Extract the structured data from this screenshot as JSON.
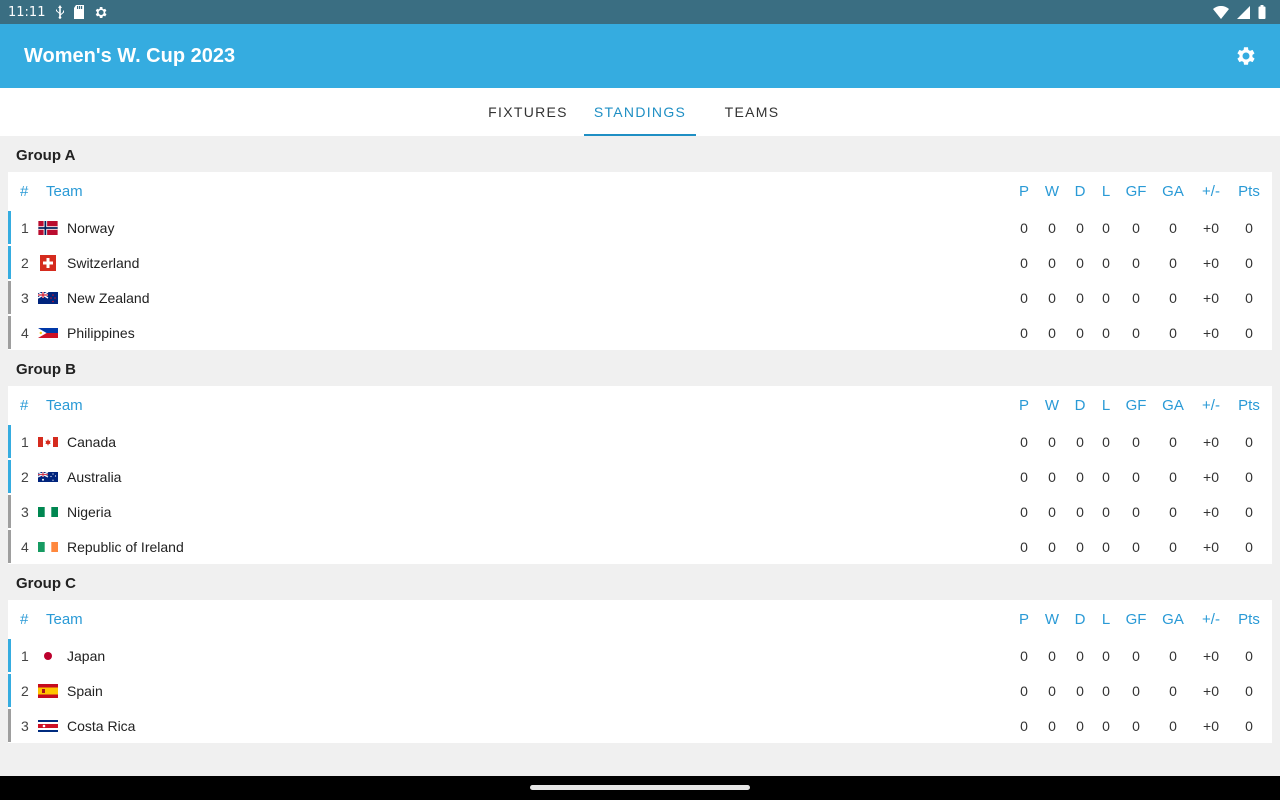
{
  "status_bar": {
    "time": "11:11",
    "icons": [
      "usb-icon",
      "sd-card-icon",
      "settings-sync-icon",
      "wifi-icon",
      "signal-icon",
      "battery-icon"
    ]
  },
  "app_bar": {
    "title": "Women's W. Cup 2023",
    "settings_icon": "gear-icon",
    "color": "#35ace0"
  },
  "tabs": [
    {
      "label": "FIXTURES",
      "active": false
    },
    {
      "label": "STANDINGS",
      "active": true
    },
    {
      "label": "TEAMS",
      "active": false
    }
  ],
  "table_headers": {
    "rank": "#",
    "team": "Team",
    "p": "P",
    "w": "W",
    "d": "D",
    "l": "L",
    "gf": "GF",
    "ga": "GA",
    "pm": "+/-",
    "pts": "Pts"
  },
  "colors": {
    "qualify": "#35ace0",
    "eliminated": "#9e9e9e",
    "accent": "#1f8fc4"
  },
  "groups": [
    {
      "name": "Group A",
      "teams": [
        {
          "rank": "1",
          "name": "Norway",
          "flag": "norway",
          "p": "0",
          "w": "0",
          "d": "0",
          "l": "0",
          "gf": "0",
          "ga": "0",
          "pm": "+0",
          "pts": "0",
          "qualify": true
        },
        {
          "rank": "2",
          "name": "Switzerland",
          "flag": "switzerland",
          "p": "0",
          "w": "0",
          "d": "0",
          "l": "0",
          "gf": "0",
          "ga": "0",
          "pm": "+0",
          "pts": "0",
          "qualify": true
        },
        {
          "rank": "3",
          "name": "New Zealand",
          "flag": "new-zealand",
          "p": "0",
          "w": "0",
          "d": "0",
          "l": "0",
          "gf": "0",
          "ga": "0",
          "pm": "+0",
          "pts": "0",
          "qualify": false
        },
        {
          "rank": "4",
          "name": "Philippines",
          "flag": "philippines",
          "p": "0",
          "w": "0",
          "d": "0",
          "l": "0",
          "gf": "0",
          "ga": "0",
          "pm": "+0",
          "pts": "0",
          "qualify": false
        }
      ]
    },
    {
      "name": "Group B",
      "teams": [
        {
          "rank": "1",
          "name": "Canada",
          "flag": "canada",
          "p": "0",
          "w": "0",
          "d": "0",
          "l": "0",
          "gf": "0",
          "ga": "0",
          "pm": "+0",
          "pts": "0",
          "qualify": true
        },
        {
          "rank": "2",
          "name": "Australia",
          "flag": "australia",
          "p": "0",
          "w": "0",
          "d": "0",
          "l": "0",
          "gf": "0",
          "ga": "0",
          "pm": "+0",
          "pts": "0",
          "qualify": true
        },
        {
          "rank": "3",
          "name": "Nigeria",
          "flag": "nigeria",
          "p": "0",
          "w": "0",
          "d": "0",
          "l": "0",
          "gf": "0",
          "ga": "0",
          "pm": "+0",
          "pts": "0",
          "qualify": false
        },
        {
          "rank": "4",
          "name": "Republic of Ireland",
          "flag": "ireland",
          "p": "0",
          "w": "0",
          "d": "0",
          "l": "0",
          "gf": "0",
          "ga": "0",
          "pm": "+0",
          "pts": "0",
          "qualify": false
        }
      ]
    },
    {
      "name": "Group C",
      "teams": [
        {
          "rank": "1",
          "name": "Japan",
          "flag": "japan",
          "p": "0",
          "w": "0",
          "d": "0",
          "l": "0",
          "gf": "0",
          "ga": "0",
          "pm": "+0",
          "pts": "0",
          "qualify": true
        },
        {
          "rank": "2",
          "name": "Spain",
          "flag": "spain",
          "p": "0",
          "w": "0",
          "d": "0",
          "l": "0",
          "gf": "0",
          "ga": "0",
          "pm": "+0",
          "pts": "0",
          "qualify": true
        },
        {
          "rank": "3",
          "name": "Costa Rica",
          "flag": "costa-rica",
          "p": "0",
          "w": "0",
          "d": "0",
          "l": "0",
          "gf": "0",
          "ga": "0",
          "pm": "+0",
          "pts": "0",
          "qualify": false
        }
      ]
    }
  ]
}
